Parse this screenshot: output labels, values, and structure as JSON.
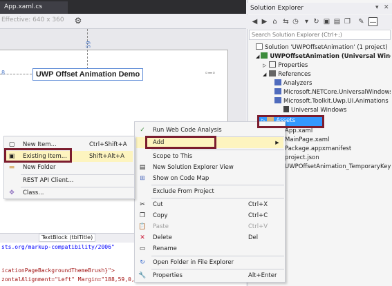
{
  "document": {
    "tab_title": "App.xaml.cs",
    "effective_size": "Effective: 640 x 360",
    "margin_left": "8",
    "margin_top": "59",
    "title_text": "UWP Offset Animation Demo",
    "crumb": "TextBlock (tblTitle)",
    "code_lines": [
      "sts.org/markup-compatibility/2006\"",
      "",
      "icationPageBackgroundThemeBrush}\">",
      "zontalAlignment=\"Left\" Margin=\"188,59,0,"
    ]
  },
  "solution_explorer": {
    "title": "Solution Explorer",
    "search_placeholder": "Search Solution Explorer (Ctrl+;)",
    "tree": [
      "Solution 'UWPOffsetAnimation' (1 project)",
      "UWPOffsetAnimation (Universal Windows)",
      "Properties",
      "References",
      "Analyzers",
      "Microsoft.NETCore.UniversalWindowsPlatform",
      "Microsoft.Toolkit.Uwp.UI.Animations",
      "Universal Windows",
      "Assets",
      "App.xaml",
      "MainPage.xaml",
      "Package.appxmanifest",
      "project.json",
      "UWPOffsetAnimation_TemporaryKey.pfx"
    ]
  },
  "menu_left": {
    "items": [
      {
        "label": "New Item...",
        "shortcut": "Ctrl+Shift+A"
      },
      {
        "label": "Existing Item...",
        "shortcut": "Shift+Alt+A"
      },
      {
        "label": "New Folder",
        "shortcut": ""
      },
      {
        "label": "REST API Client...",
        "shortcut": ""
      },
      {
        "label": "Class...",
        "shortcut": ""
      }
    ]
  },
  "menu_right": {
    "items": [
      {
        "label": "Run Web Code Analysis",
        "shortcut": ""
      },
      {
        "label": "Add",
        "shortcut": ""
      },
      {
        "label": "Scope to This",
        "shortcut": ""
      },
      {
        "label": "New Solution Explorer View",
        "shortcut": ""
      },
      {
        "label": "Show on Code Map",
        "shortcut": ""
      },
      {
        "label": "Exclude From Project",
        "shortcut": ""
      },
      {
        "label": "Cut",
        "shortcut": "Ctrl+X"
      },
      {
        "label": "Copy",
        "shortcut": "Ctrl+C"
      },
      {
        "label": "Paste",
        "shortcut": "Ctrl+V"
      },
      {
        "label": "Delete",
        "shortcut": "Del"
      },
      {
        "label": "Rename",
        "shortcut": ""
      },
      {
        "label": "Open Folder in File Explorer",
        "shortcut": ""
      },
      {
        "label": "Properties",
        "shortcut": "Alt+Enter"
      }
    ]
  },
  "colors": {
    "selection": "#3399ff",
    "highlight_box": "#7b1c2e",
    "hover_item": "#fdf4bf",
    "string_red": "#a31515",
    "link_blue": "#0000ff"
  }
}
